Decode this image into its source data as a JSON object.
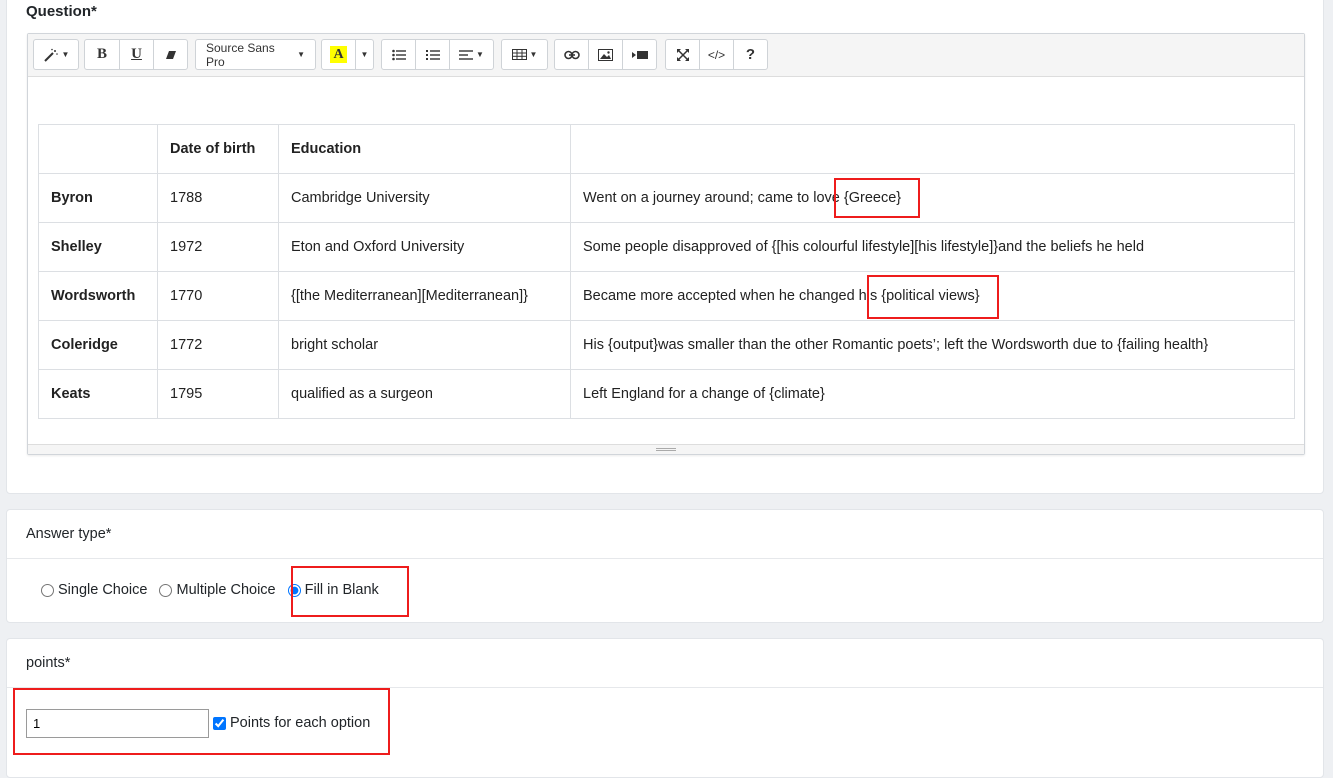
{
  "question": {
    "label": "Question*",
    "toolbar": {
      "font_name": "Source Sans Pro",
      "highlight_letter": "A",
      "help_label": "?",
      "code_label": "</>"
    },
    "table": {
      "headers": [
        "",
        "Date of birth",
        "Education",
        ""
      ],
      "rows": [
        {
          "name": "Byron",
          "year": "1788",
          "education": "Cambridge University",
          "notes": "Went on a journey around; came to love {Greece}"
        },
        {
          "name": "Shelley",
          "year": "1972",
          "education": "Eton and Oxford University",
          "notes": "Some people disapproved of {[his colourful lifestyle][his lifestyle]}and the beliefs he held"
        },
        {
          "name": "Wordsworth",
          "year": "1770",
          "education": "{[the Mediterranean][Mediterranean]}",
          "notes": "Became more accepted when he changed his {political views}"
        },
        {
          "name": "Coleridge",
          "year": "1772",
          "education": "bright scholar",
          "notes": "His {output}was smaller than the other Romantic poets’; left the Wordsworth due to {failing health}"
        },
        {
          "name": "Keats",
          "year": "1795",
          "education": "qualified as a surgeon",
          "notes": "Left England for a change of {climate}"
        }
      ]
    }
  },
  "answer_type": {
    "label": "Answer type*",
    "options": [
      "Single Choice",
      "Multiple Choice",
      "Fill in Blank"
    ],
    "selected": "Fill in Blank"
  },
  "points": {
    "label": "points*",
    "value": "1",
    "each_option_label": "Points for each option",
    "each_option_checked": true
  },
  "colors": {
    "highlight_box": "#ee1c1c",
    "text_highlight": "#ffff00"
  }
}
